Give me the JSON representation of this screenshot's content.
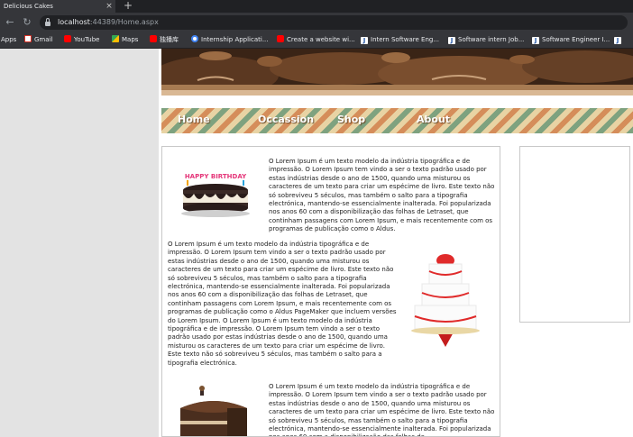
{
  "browser": {
    "tab_title": "Delicious Cakes",
    "tab_close": "×",
    "new_tab": "+",
    "back": "←",
    "reload": "↻",
    "url_host": "localhost",
    "url_rest": ":44389/Home.aspx"
  },
  "bookmarks": [
    {
      "label": "Apps"
    },
    {
      "label": "Gmail"
    },
    {
      "label": "YouTube"
    },
    {
      "label": "Maps"
    },
    {
      "label": "独播库"
    },
    {
      "label": "Internship Applicati..."
    },
    {
      "label": "Create a website wi..."
    },
    {
      "label": "Intern Software Eng..."
    },
    {
      "label": "Software intern Job..."
    },
    {
      "label": "Software Engineer I..."
    }
  ],
  "menu": {
    "home": "Home",
    "occassion": "Occassion",
    "shop": "Shop",
    "about": "About"
  },
  "content": {
    "para1": "O Lorem Ipsum é um texto modelo da indústria tipográfica e de impressão. O Lorem Ipsum tem vindo a ser o texto padrão usado por estas indústrias desde o ano de 1500, quando uma misturou os caracteres de um texto para criar um espécime de livro. Este texto não só sobreviveu 5 séculos, mas também o salto para a tipografia electrónica, mantendo-se essencialmente inalterada. Foi popularizada nos anos 60 com a disponibilização das folhas de Letraset, que continham passagens com Lorem Ipsum, e mais recentemente com os programas de publicação como o Aldus.",
    "para2": "O Lorem Ipsum é um texto modelo da indústria tipográfica e de impressão. O Lorem Ipsum tem vindo a ser o texto padrão usado por estas indústrias desde o ano de 1500, quando uma misturou os caracteres de um texto para criar um espécime de livro. Este texto não só sobreviveu 5 séculos, mas também o salto para a tipografia electrónica, mantendo-se essencialmente inalterada. Foi popularizada nos anos 60 com a disponibilização das folhas de Letraset, que continham passagens com Lorem Ipsum, e mais recentemente com os programas de publicação como o Aldus PageMaker que incluem versões do Lorem Ipsum. O Lorem Ipsum é um texto modelo da indústria tipográfica e de impressão. O Lorem Ipsum tem vindo a ser o texto padrão usado por estas indústrias desde o ano de 1500, quando uma misturou os caracteres de um texto para criar um espécime de livro. Este texto não só sobreviveu 5 séculos, mas também o salto para a tipografia electrónica.",
    "para3": "O Lorem Ipsum é um texto modelo da indústria tipográfica e de impressão. O Lorem Ipsum tem vindo a ser o texto padrão usado por estas indústrias desde o ano de 1500, quando uma misturou os caracteres de um texto para criar um espécime de livro. Este texto não só sobreviveu 5 séculos, mas também o salto para a tipografia electrónica, mantendo-se essencialmente inalterada. Foi popularizada nos anos 60 com a disponibilização das folhas de"
  },
  "images": {
    "birthday_cake_text": "HAPPY BIRTHDAY"
  },
  "colors": {
    "chrome_dark": "#202124",
    "chrome_toolbar": "#35363a",
    "menu_text": "#ffffff"
  }
}
